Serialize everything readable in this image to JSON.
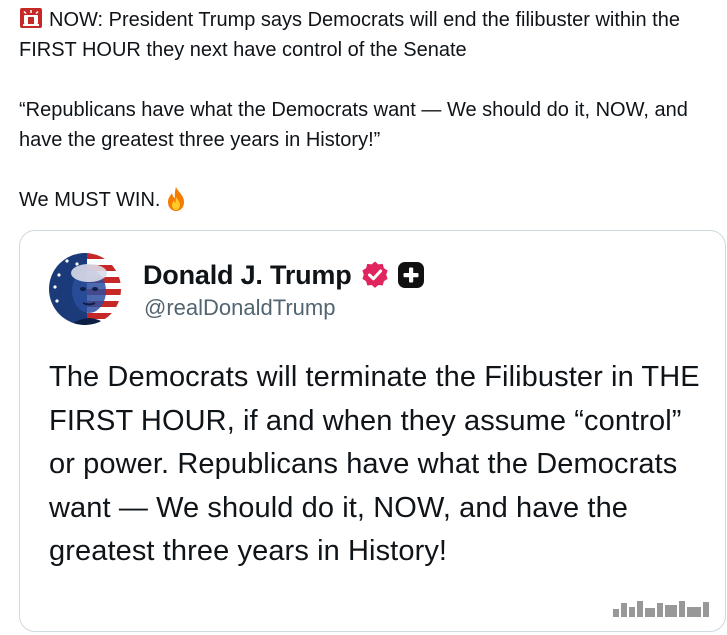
{
  "tweet": {
    "line1_rest": "NOW: President Trump says Democrats will end the filibuster within the FIRST HOUR they next have control of the Senate",
    "quote": "“Republicans have what the Democrats want — We should do it, NOW, and have the greatest three years in History!”",
    "closing": "We MUST WIN.",
    "icons": [
      "siren-icon",
      "fire-icon"
    ]
  },
  "quoted_post": {
    "author_name": "Donald J. Trump",
    "author_handle": "@realDonaldTrump",
    "body": "The Democrats will terminate the Filibuster in THE FIRST HOUR, if and when they assume “control” or power. Republicans have what the Democrats want — We should do it, NOW, and have the greatest three years in History!",
    "badges": [
      "verified-badge-icon",
      "plus-badge-icon"
    ]
  },
  "colors": {
    "text": "#0f1419",
    "secondary_text": "#536471",
    "border": "#cfd9de",
    "verified_pink": "#e0245e"
  }
}
